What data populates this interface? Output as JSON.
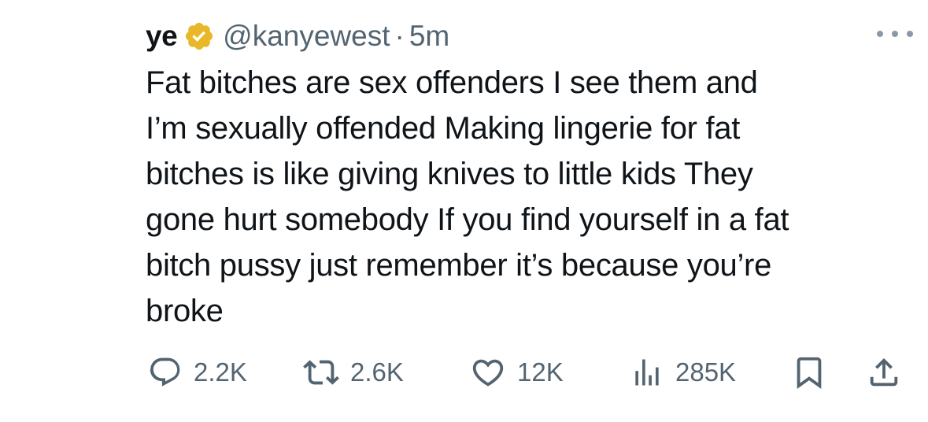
{
  "tweet": {
    "display_name": "ye",
    "handle": "@kanyewest",
    "separator": "·",
    "timestamp": "5m",
    "verified": true,
    "badge_color": "#e8b829",
    "text": "Fat bitches are sex offenders    I see them and\nI’m sexually offended      Making lingerie for fat\nbitches is like giving knives to little kids   They\ngone hurt somebody   If you find yourself in a fat\nbitch pussy just remember it’s because you’re\nbroke"
  },
  "actions": {
    "reply_count": "2.2K",
    "repost_count": "2.6K",
    "like_count": "12K",
    "views_count": "285K"
  },
  "icons": {
    "verified": "verified-badge-icon",
    "more": "more-dots-icon",
    "reply": "reply-icon",
    "repost": "repost-icon",
    "like": "heart-icon",
    "views": "views-bar-chart-icon",
    "bookmark": "bookmark-icon",
    "share": "share-icon"
  },
  "colors": {
    "text_primary": "#0f1419",
    "text_secondary": "#536471",
    "icon": "#536471"
  }
}
